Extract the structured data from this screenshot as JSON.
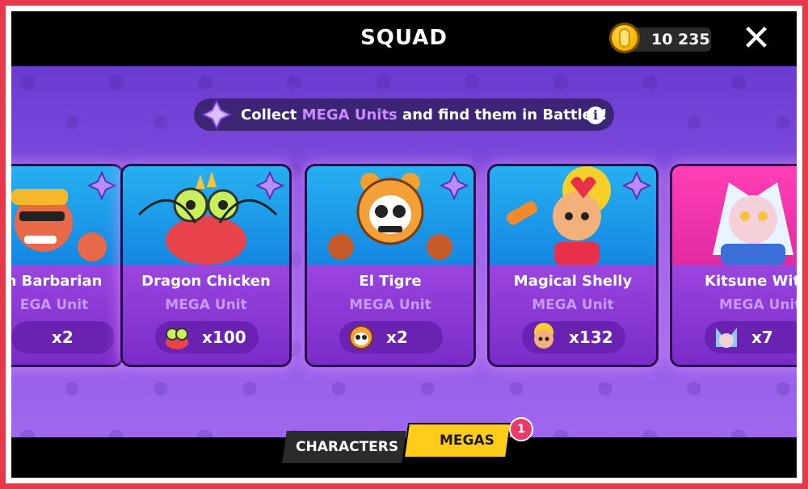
{
  "header": {
    "title": "SQUAD",
    "coins": "10 235",
    "close_label": "✕"
  },
  "banner": {
    "text_before": "Collect ",
    "text_highlight": "MEGA Units",
    "text_after": " and find them in Battles!",
    "info_label": "i"
  },
  "cards": [
    {
      "name": "n Barbarian",
      "tag": "EGA Unit",
      "count": "x2",
      "bg": "blue"
    },
    {
      "name": "Dragon Chicken",
      "tag": "MEGA Unit",
      "count": "x100",
      "bg": "blue"
    },
    {
      "name": "El Tigre",
      "tag": "MEGA Unit",
      "count": "x2",
      "bg": "blue"
    },
    {
      "name": "Magical Shelly",
      "tag": "MEGA Unit",
      "count": "x132",
      "bg": "blue"
    },
    {
      "name": "Kitsune Witc",
      "tag": "MEGA Unit",
      "count": "x7",
      "bg": "pink"
    }
  ],
  "tabs": {
    "characters": "CHARACTERS",
    "megas": "MEGAS",
    "megas_badge": "1"
  },
  "colors": {
    "accent_purple": "#8e3fd9",
    "tab_active": "#ffcc1a",
    "badge": "#e83a6c",
    "frame": "#e8394a"
  }
}
